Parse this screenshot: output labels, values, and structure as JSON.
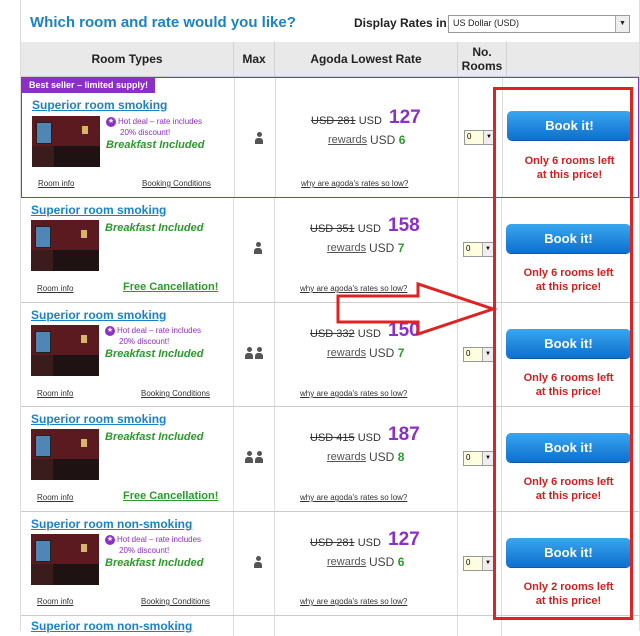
{
  "header": {
    "title": "Which room and rate would you like?",
    "rates_label": "Display Rates in:",
    "currency": "US Dollar (USD)"
  },
  "columns": [
    "Room Types",
    "Max",
    "Agoda Lowest Rate",
    "No. Rooms"
  ],
  "best_badge": "Best seller – limited supply!",
  "deal_text_1": "Hot deal – rate includes",
  "deal_text_2": "20% discount!",
  "breakfast": "Breakfast Included",
  "room_info": "Room info",
  "booking_conditions": "Booking Conditions",
  "free_cancellation": "Free Cancellation!",
  "why_link": "why are agoda's rates so low?",
  "usd": "USD",
  "rewards": "rewards",
  "book_label": "Book it!",
  "rooms": [
    {
      "name": "Superior room smoking",
      "old": "USD 281",
      "new": "127",
      "reward": "6",
      "qty": "0",
      "left1": "Only 6 rooms left",
      "left2": "at this price!"
    },
    {
      "name": "Superior room smoking",
      "old": "USD 351",
      "new": "158",
      "reward": "7",
      "qty": "0",
      "left1": "Only 6 rooms left",
      "left2": "at this price!"
    },
    {
      "name": "Superior room smoking",
      "old": "USD 332",
      "new": "150",
      "reward": "7",
      "qty": "0",
      "left1": "Only 6 rooms left",
      "left2": "at this price!"
    },
    {
      "name": "Superior room smoking",
      "old": "USD 415",
      "new": "187",
      "reward": "8",
      "qty": "0",
      "left1": "Only 6 rooms left",
      "left2": "at this price!"
    },
    {
      "name": "Superior room non-smoking",
      "old": "USD 281",
      "new": "127",
      "reward": "6",
      "qty": "0",
      "left1": "Only 2 rooms left",
      "left2": "at this price!"
    },
    {
      "name": "Superior room non-smoking"
    }
  ],
  "colors": {
    "accent": "#1b83c5",
    "purple": "#8b2fc9",
    "green": "#2b9a2b",
    "red": "#d21f1f"
  }
}
